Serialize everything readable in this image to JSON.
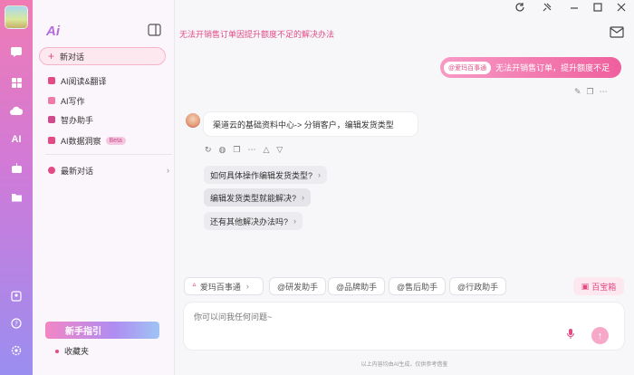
{
  "rail": {
    "icons": [
      "chat-icon",
      "grid-icon",
      "cloud-icon",
      "ai-icon",
      "robot-icon",
      "folder-icon",
      "user-card-icon",
      "help-icon",
      "settings-icon"
    ],
    "active_label": "AI"
  },
  "window": {
    "controls": [
      "refresh-icon",
      "pin-icon",
      "minimize-icon",
      "maximize-icon",
      "close-icon"
    ]
  },
  "sidebar": {
    "logo": "Ai",
    "new_chat": "新对话",
    "items": [
      {
        "label": "AI阅读&翻译",
        "color": "#e24b86"
      },
      {
        "label": "AI写作",
        "color": "#e24b86"
      },
      {
        "label": "智办助手",
        "color": "#d24a8d"
      },
      {
        "label": "AI数据洞察",
        "color": "#e24b86",
        "badge": "Beta"
      }
    ],
    "recent": "最新对话",
    "guide": "新手指引",
    "favorites": "收藏夹"
  },
  "main": {
    "title": "无法开销售订单因提升额度不足的解决办法",
    "user_message": {
      "tag": "@爱玛百事通",
      "text": "无法开销售订单，提升额度不足"
    },
    "bot_message": "渠道云的基础资料中心-> 分销客户，编辑发货类型",
    "suggestions": [
      "如何具体操作编辑发货类型?",
      "编辑发货类型就能解决?",
      "还有其他解决办法吗?"
    ],
    "tools": [
      {
        "label": "爱玛百事通",
        "icon": "spark-icon"
      },
      {
        "label": "@研发助手"
      },
      {
        "label": "@品牌助手"
      },
      {
        "label": "@售后助手"
      },
      {
        "label": "@行政助手"
      }
    ],
    "treasure_box": "百宝箱",
    "input_placeholder": "你可以问我任何问题~",
    "disclaimer": "以上内容均由AI生成，仅供参考借鉴"
  },
  "colors": {
    "accent": "#e24b86",
    "rail_top": "#f07bb4",
    "rail_bottom": "#9a8ef0"
  }
}
